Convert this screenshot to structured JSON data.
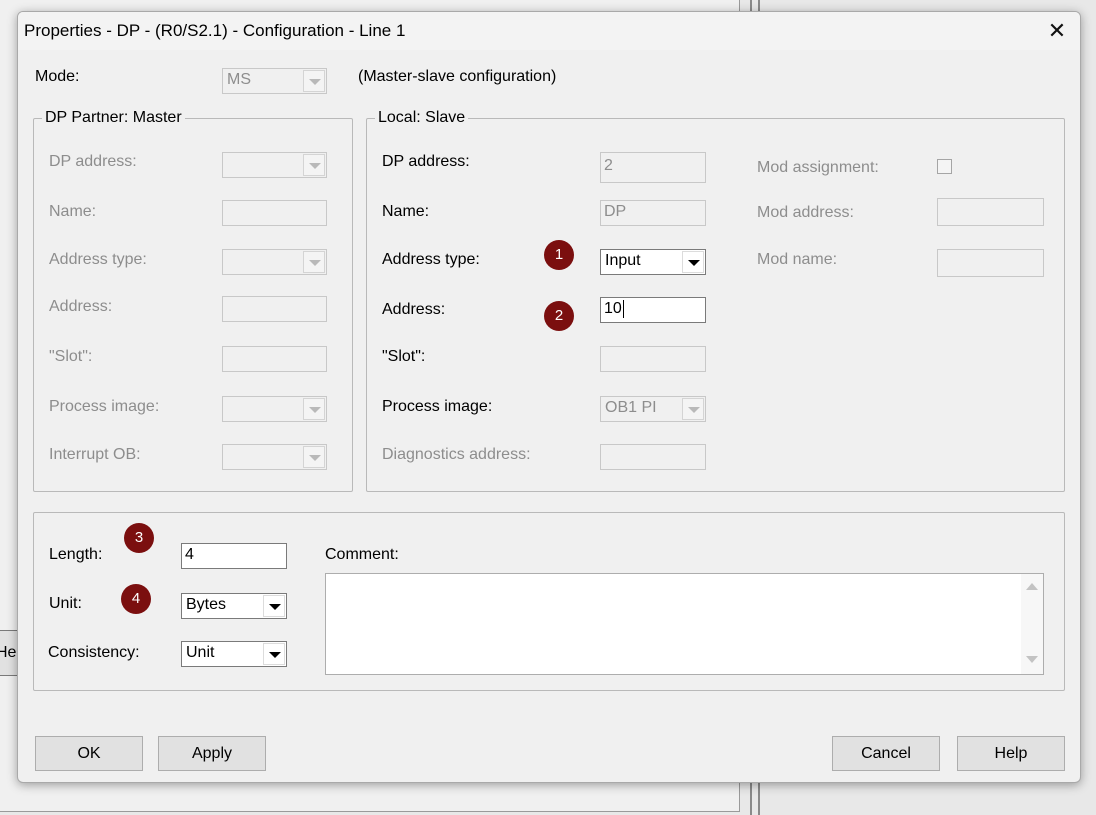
{
  "dialog": {
    "title": "Properties - DP - (R0/S2.1) - Configuration - Line 1",
    "close_label": "✕"
  },
  "background": {
    "help_fragment": "Hel"
  },
  "mode": {
    "label": "Mode:",
    "value": "MS",
    "description": "(Master-slave configuration)"
  },
  "partner": {
    "legend": "DP Partner: Master",
    "dp_address_label": "DP address:",
    "name_label": "Name:",
    "address_type_label": "Address type:",
    "address_label": "Address:",
    "slot_label": "\"Slot\":",
    "process_image_label": "Process image:",
    "interrupt_ob_label": "Interrupt OB:"
  },
  "local": {
    "legend": "Local: Slave",
    "dp_address_label": "DP address:",
    "dp_address_value": "2",
    "name_label": "Name:",
    "name_value": "DP",
    "address_type_label": "Address type:",
    "address_type_value": "Input",
    "address_label": "Address:",
    "address_value": "10",
    "slot_label": "\"Slot\":",
    "process_image_label": "Process image:",
    "process_image_value": "OB1 PI",
    "diagnostics_label": "Diagnostics address:",
    "mod_assignment_label": "Mod assignment:",
    "mod_address_label": "Mod address:",
    "mod_name_label": "Mod name:"
  },
  "bottom": {
    "length_label": "Length:",
    "length_value": "4",
    "unit_label": "Unit:",
    "unit_value": "Bytes",
    "consistency_label": "Consistency:",
    "consistency_value": "Unit",
    "comment_label": "Comment:"
  },
  "badges": [
    "1",
    "2",
    "3",
    "4"
  ],
  "buttons": {
    "ok": "OK",
    "apply": "Apply",
    "cancel": "Cancel",
    "help": "Help"
  },
  "colors": {
    "badge": "#7b0f0f",
    "disabled_text": "#8d8d8d",
    "dialog_bg": "#f0f0f0"
  }
}
